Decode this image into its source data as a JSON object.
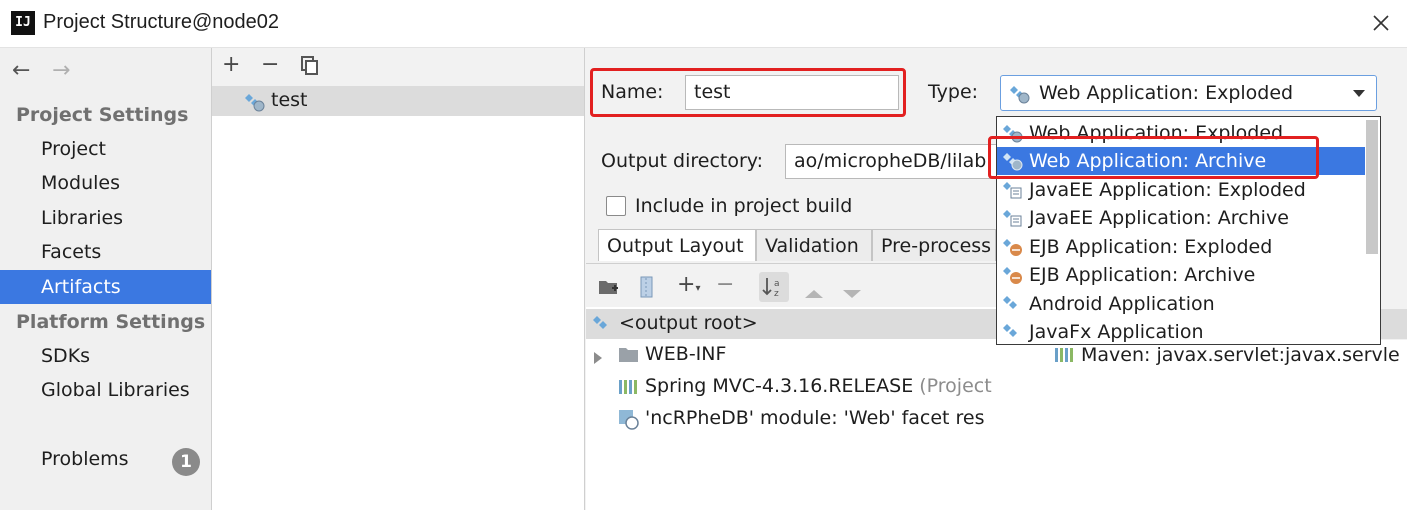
{
  "window": {
    "title": "Project Structure@node02",
    "app_icon_text": "IJ"
  },
  "nav": {
    "back": "←",
    "forward": "→"
  },
  "sidebar": {
    "project_settings_heading": "Project Settings",
    "project_items": [
      "Project",
      "Modules",
      "Libraries",
      "Facets",
      "Artifacts"
    ],
    "platform_settings_heading": "Platform Settings",
    "platform_items": [
      "SDKs",
      "Global Libraries"
    ],
    "problems_label": "Problems",
    "problems_count": "1",
    "selected": "Artifacts"
  },
  "artifact_list": {
    "toolbar": {
      "add": "+",
      "remove": "−"
    },
    "items": [
      "test"
    ]
  },
  "editor": {
    "name_label": "Name:",
    "name_value": "test",
    "type_label": "Type:",
    "type_value": "Web Application: Exploded",
    "output_dir_label": "Output directory:",
    "output_dir_value": "ao/micropheDB/lilab",
    "include_label": "Include in project build",
    "include_checked": false,
    "tabs": [
      "Output Layout",
      "Validation",
      "Pre-process"
    ],
    "active_tab": "Output Layout",
    "layout_tree": [
      {
        "label": "<output root>",
        "icon": "artifact-icon"
      },
      {
        "label": "WEB-INF",
        "icon": "folder-icon"
      },
      {
        "label": "Spring MVC-4.3.16.RELEASE",
        "suffix": "(Project",
        "icon": "library-icon"
      },
      {
        "label": "'ncRPheDB' module: 'Web' facet res",
        "icon": "web-facet-icon"
      }
    ],
    "available_items": [
      {
        "label": "Maven: javax.servlet:javax.servle",
        "icon": "library-icon"
      }
    ]
  },
  "type_dropdown": {
    "options": [
      "Web Application: Exploded",
      "Web Application: Archive",
      "JavaEE Application: Exploded",
      "JavaEE Application: Archive",
      "EJB Application: Exploded",
      "EJB Application: Archive",
      "Android Application",
      "JavaFx Application"
    ],
    "highlighted": "Web Application: Archive"
  },
  "colors": {
    "selection": "#3b78e1",
    "highlight_box": "#e22020"
  }
}
